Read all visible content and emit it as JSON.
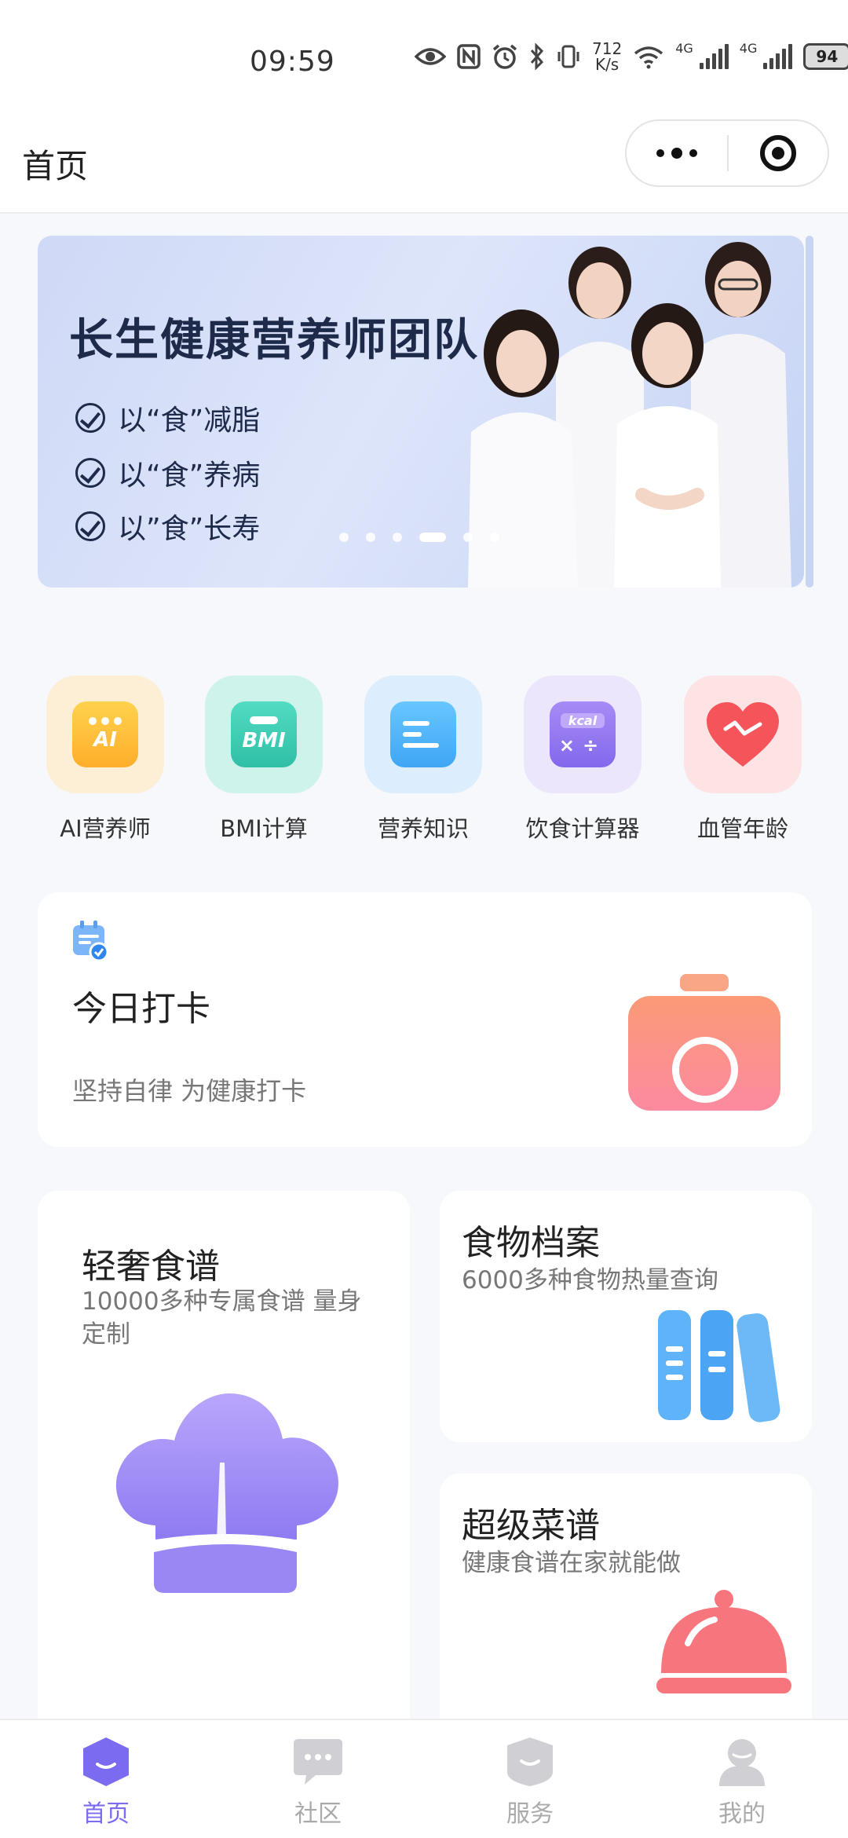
{
  "status_bar": {
    "time": "09:59",
    "speed_value": "712",
    "speed_unit": "K/s",
    "network_label_1": "4G",
    "network_label_2": "4G",
    "battery": "94"
  },
  "nav": {
    "title": "首页"
  },
  "banner": {
    "title": "长生健康营养师团队",
    "lines": [
      "以“食”减脂",
      "以“食”养病",
      "以”食”长寿"
    ],
    "slide_count": 6,
    "active_slide": 4
  },
  "quick_actions": [
    {
      "label": "AI营养师",
      "icon": "ai-nutritionist-icon",
      "badge": "AI"
    },
    {
      "label": "BMI计算",
      "icon": "bmi-icon",
      "badge": "BMI"
    },
    {
      "label": "营养知识",
      "icon": "document-icon"
    },
    {
      "label": "饮食计算器",
      "icon": "calculator-icon",
      "badge": "kcal"
    },
    {
      "label": "血管年龄",
      "icon": "heart-icon"
    }
  ],
  "checkin": {
    "title": "今日打卡",
    "subtitle": "坚持自律 为健康打卡"
  },
  "recipe": {
    "title": "轻奢食谱",
    "subtitle": "10000多种专属食谱 量身定制"
  },
  "food_archive": {
    "title": "食物档案",
    "subtitle": "6000多种食物热量查询"
  },
  "super_recipe": {
    "title": "超级菜谱",
    "subtitle": "健康食谱在家就能做"
  },
  "tabs": [
    {
      "label": "首页",
      "active": true
    },
    {
      "label": "社区",
      "active": false
    },
    {
      "label": "服务",
      "active": false
    },
    {
      "label": "我的",
      "active": false
    }
  ],
  "colors": {
    "accent": "#7a6bf0",
    "inactive_tab": "#c8c8cc"
  }
}
